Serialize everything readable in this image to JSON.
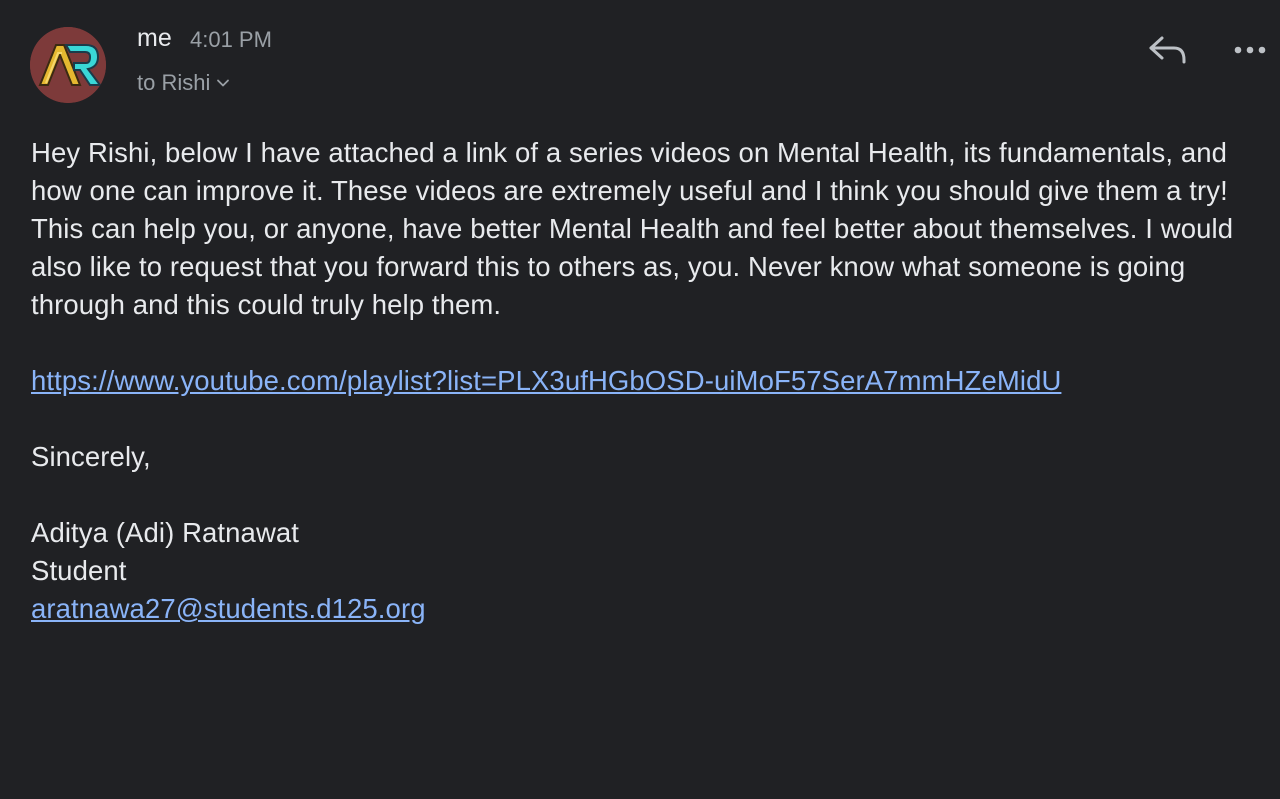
{
  "header": {
    "sender": "me",
    "time": "4:01 PM",
    "recipient": "to Rishi"
  },
  "actions": {
    "reply_icon": "reply-icon",
    "more_icon": "more-horizontal-icon"
  },
  "message": {
    "paragraph": "Hey Rishi, below I have attached a link of a series videos on Mental Health, its fundamentals, and how one can improve it. These videos are extremely useful and I think you should give them a try! This can help you, or anyone, have better Mental Health and feel better about themselves. I would also like to request that you forward this to others as, you. Never know what someone is going through and this could truly help them.",
    "link": "https://www.youtube.com/playlist?list=PLX3ufHGbOSD-uiMoF57SerA7mmHZeMidU",
    "closing": "Sincerely,",
    "signature_name": "Aditya (Adi) Ratnawat",
    "signature_title": "Student",
    "signature_email": "aratnawa27@students.d125.org"
  },
  "colors": {
    "background": "#202124",
    "text": "#e8eaed",
    "muted": "#9aa0a6",
    "link": "#8ab4f8"
  }
}
